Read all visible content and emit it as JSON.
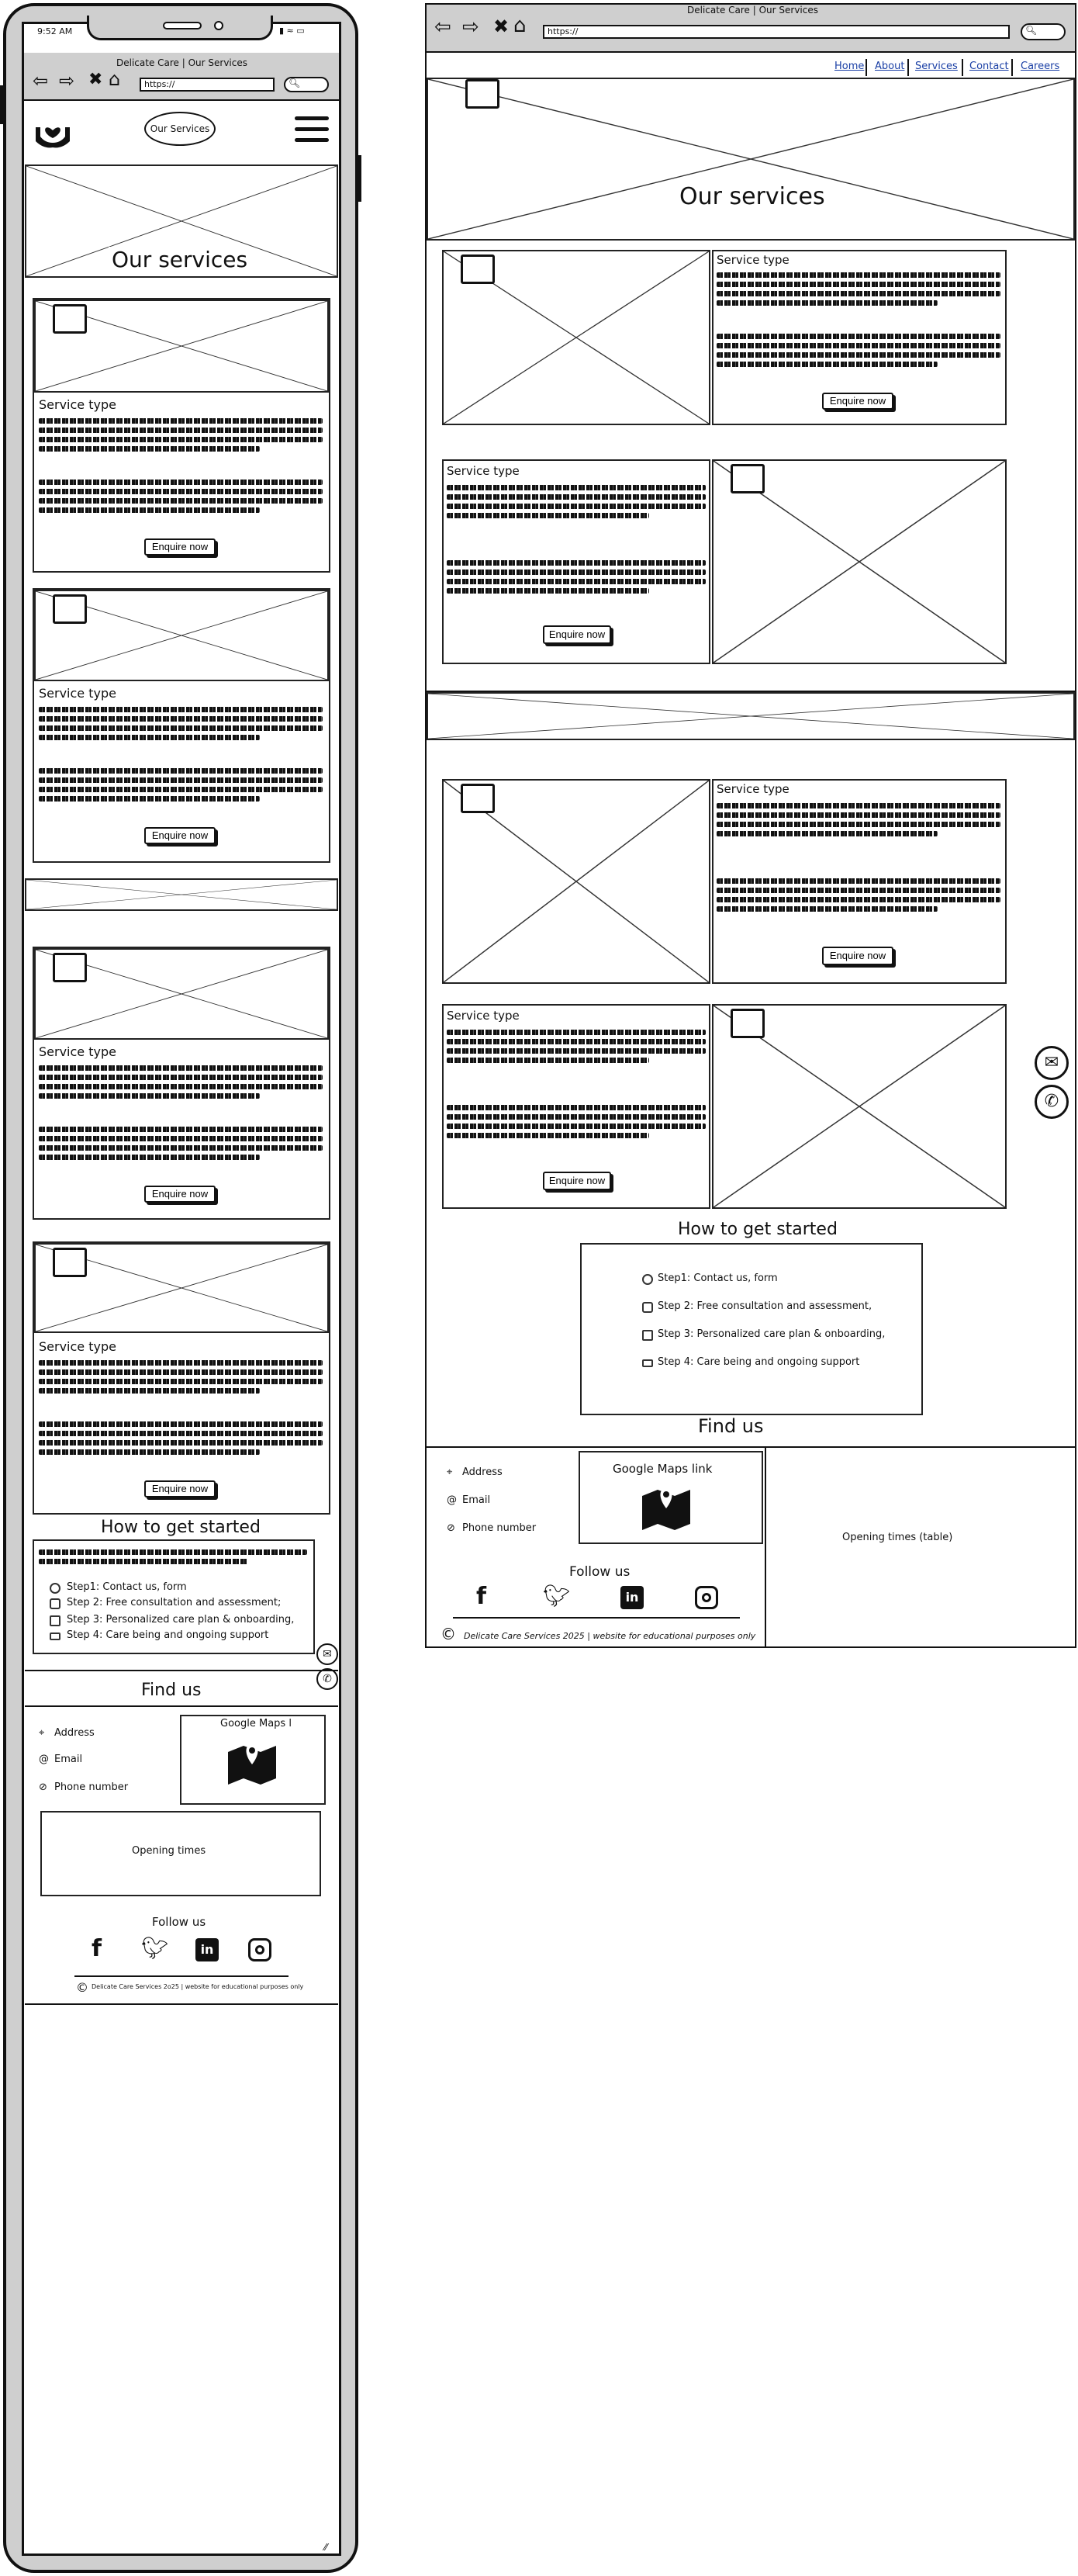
{
  "browser": {
    "title": "Delicate Care | Our Services",
    "url": "https://"
  },
  "mobile": {
    "status_time": "9:52 AM",
    "nav_button": "Our Services",
    "hero_title": "Our services",
    "services": [
      {
        "title": "Service type",
        "button": "Enquire now"
      },
      {
        "title": "Service type",
        "button": "Enquire now"
      },
      {
        "title": "Service type",
        "button": "Enquire now"
      },
      {
        "title": "Service type",
        "button": "Enquire now"
      }
    ],
    "how_title": "How to get started",
    "steps": [
      "Step1: Contact us, form",
      "Step 2: Free consultation and assessment;",
      "Step 3: Personalized care plan & onboarding,",
      "Step 4:  Care being and ongoing support"
    ],
    "find_title": "Find us",
    "address": "Address",
    "email": "Email",
    "phone": "Phone number",
    "maps": "Google Maps l",
    "opening": "Opening times",
    "follow": "Follow us",
    "copyright": "Delicate Care Services 2o25 | website for educational purposes only"
  },
  "desktop": {
    "nav": [
      "Home",
      "About",
      "Services",
      "Contact",
      "Careers"
    ],
    "hero_title": "Our services",
    "services": [
      {
        "title": "Service type",
        "button": "Enquire now"
      },
      {
        "title": "Service type",
        "button": "Enquire now"
      },
      {
        "title": "Service type",
        "button": "Enquire now"
      },
      {
        "title": "Service type",
        "button": "Enquire now"
      }
    ],
    "how_title": "How to get started",
    "steps": [
      "Step1: Contact us, form",
      "Step 2: Free consultation and assessment,",
      "Step 3: Personalized care plan & onboarding,",
      "Step 4:  Care being and ongoing support"
    ],
    "find_title": "Find us",
    "address": "Address",
    "email": "Email",
    "phone": "Phone number",
    "maps": "Google Maps link",
    "opening": "Opening times (table)",
    "follow": "Follow us",
    "copyright": "Delicate Care Services 2025 | website for educational purposes only"
  }
}
